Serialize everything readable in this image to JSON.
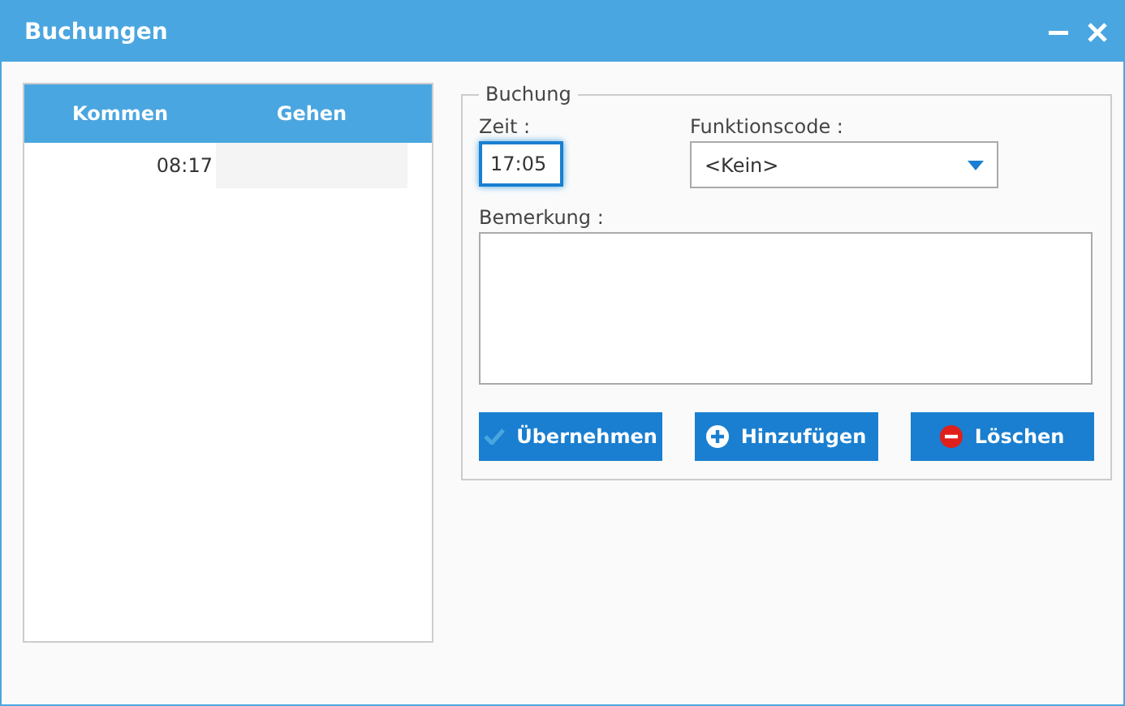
{
  "window": {
    "title": "Buchungen"
  },
  "table": {
    "columns": [
      "Kommen",
      "Gehen"
    ],
    "rows": [
      {
        "cells": [
          "08:17",
          ""
        ]
      }
    ]
  },
  "booking": {
    "legend": "Buchung",
    "time": {
      "label": "Zeit :",
      "value": "17:05",
      "focused": true
    },
    "function_code": {
      "label": "Funktionscode :",
      "value": "<Kein>"
    },
    "remark": {
      "label": "Bemerkung :"
    },
    "buttons": [
      {
        "label": "Übernehmen",
        "kind": "check"
      },
      {
        "label": "Hinzufügen",
        "kind": "add"
      },
      {
        "label": "Löschen",
        "kind": "delete"
      }
    ]
  }
}
